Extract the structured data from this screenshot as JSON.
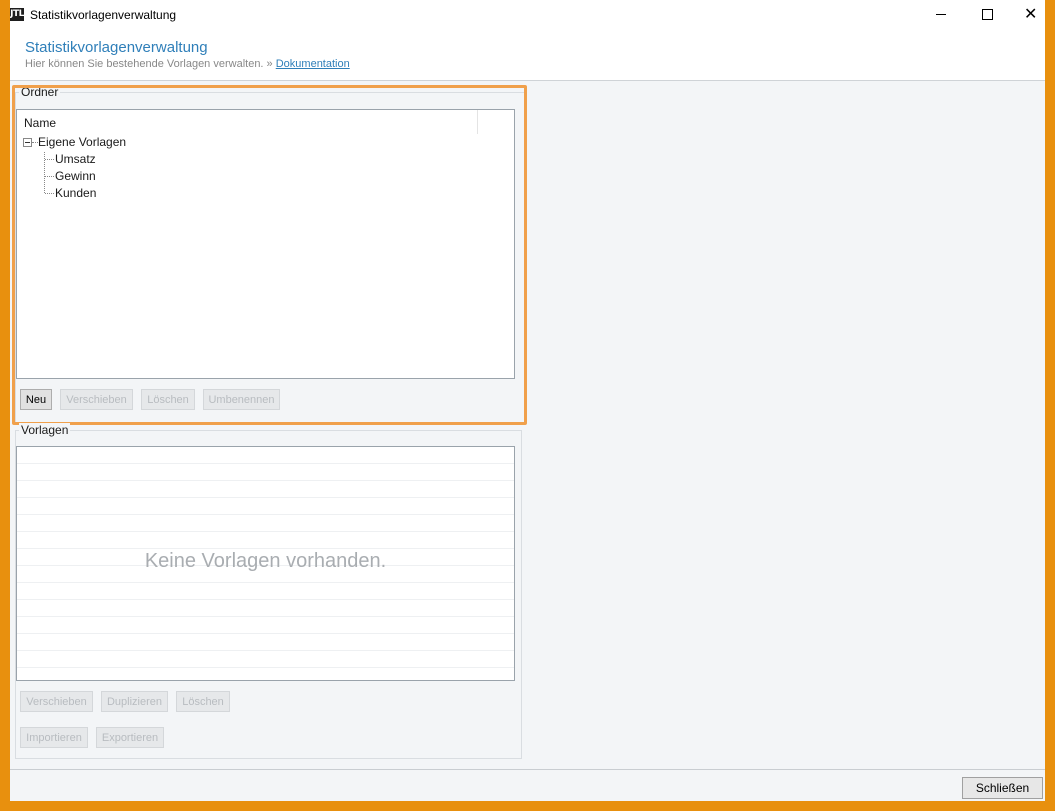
{
  "window": {
    "title": "Statistikvorlagenverwaltung",
    "icon_text": "JTL",
    "close_glyph": "✕"
  },
  "header": {
    "title": "Statistikvorlagenverwaltung",
    "subtitle": "Hier können Sie bestehende Vorlagen verwalten. »",
    "doc_link": "Dokumentation"
  },
  "ordner": {
    "group_label": "Ordner",
    "column_header": "Name",
    "root": "Eigene Vorlagen",
    "children": [
      "Umsatz",
      "Gewinn",
      "Kunden"
    ],
    "buttons": {
      "new": "Neu",
      "move": "Verschieben",
      "delete": "Löschen",
      "rename": "Umbenennen"
    }
  },
  "vorlagen": {
    "group_label": "Vorlagen",
    "empty_message": "Keine Vorlagen vorhanden.",
    "buttons": {
      "move": "Verschieben",
      "duplicate": "Duplizieren",
      "delete": "Löschen",
      "import": "Importieren",
      "export": "Exportieren"
    }
  },
  "footer": {
    "close": "Schließen"
  },
  "colors": {
    "frame": "#e8900e",
    "accent": "#2f7fb9",
    "highlight": "#f0a04b"
  }
}
